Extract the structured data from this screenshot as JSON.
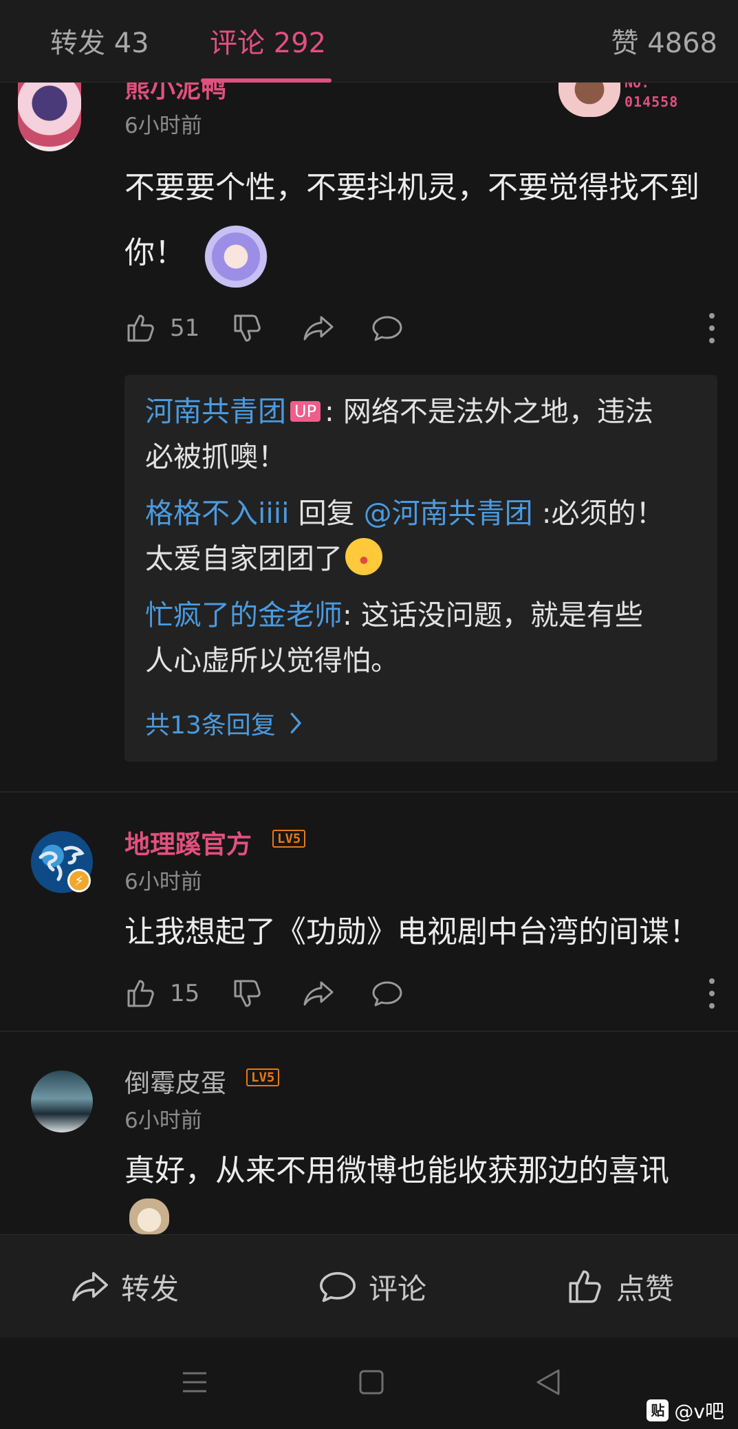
{
  "tabs": {
    "repost": "转发 43",
    "comments": "评论 292",
    "likes": "赞 4868"
  },
  "comments": [
    {
      "username": "熊小泥鸭",
      "time": "6小时前",
      "badge_no_label": "NO.",
      "badge_no_value": "014558",
      "text_line1": "不要要个性，不要抖机灵，不要觉得找不到",
      "text_line2": "你！",
      "like_count": "51",
      "username_color": "#e2507f"
    },
    {
      "username": "地理蹊官方",
      "level": "LV5",
      "time": "6小时前",
      "text": "让我想起了《功勋》电视剧中台湾的间谍！",
      "like_count": "15",
      "username_color": "#e2507f"
    },
    {
      "username": "倒霉皮蛋",
      "level": "LV5",
      "time": "6小时前",
      "text": "真好，从来不用微博也能收获那边的喜讯",
      "username_color": "#b4b4b4"
    }
  ],
  "replies": {
    "r1_user": "河南共青团",
    "r1_badge": "UP",
    "r1_text": ": 网络不是法外之地，违法",
    "r1_text2": "必被抓噢！",
    "r2_user": "格格不入iiii",
    "r2_mid": " 回复 ",
    "r2_mention": "@河南共青团",
    "r2_text": " :必须的！",
    "r2_text2": "太爱自家团团了",
    "r3_user": "忙疯了的金老师",
    "r3_text": ": 这话没问题，就是有些",
    "r3_text2": "人心虚所以觉得怕。",
    "more": "共13条回复"
  },
  "bottom_bar": {
    "repost": "转发",
    "comment": "评论",
    "like": "点赞"
  },
  "watermark": {
    "logo": "贴",
    "text": "@v吧"
  },
  "colors": {
    "accent_pink": "#e2507f",
    "link_blue": "#4a9be0",
    "level_orange": "#e57a17"
  }
}
